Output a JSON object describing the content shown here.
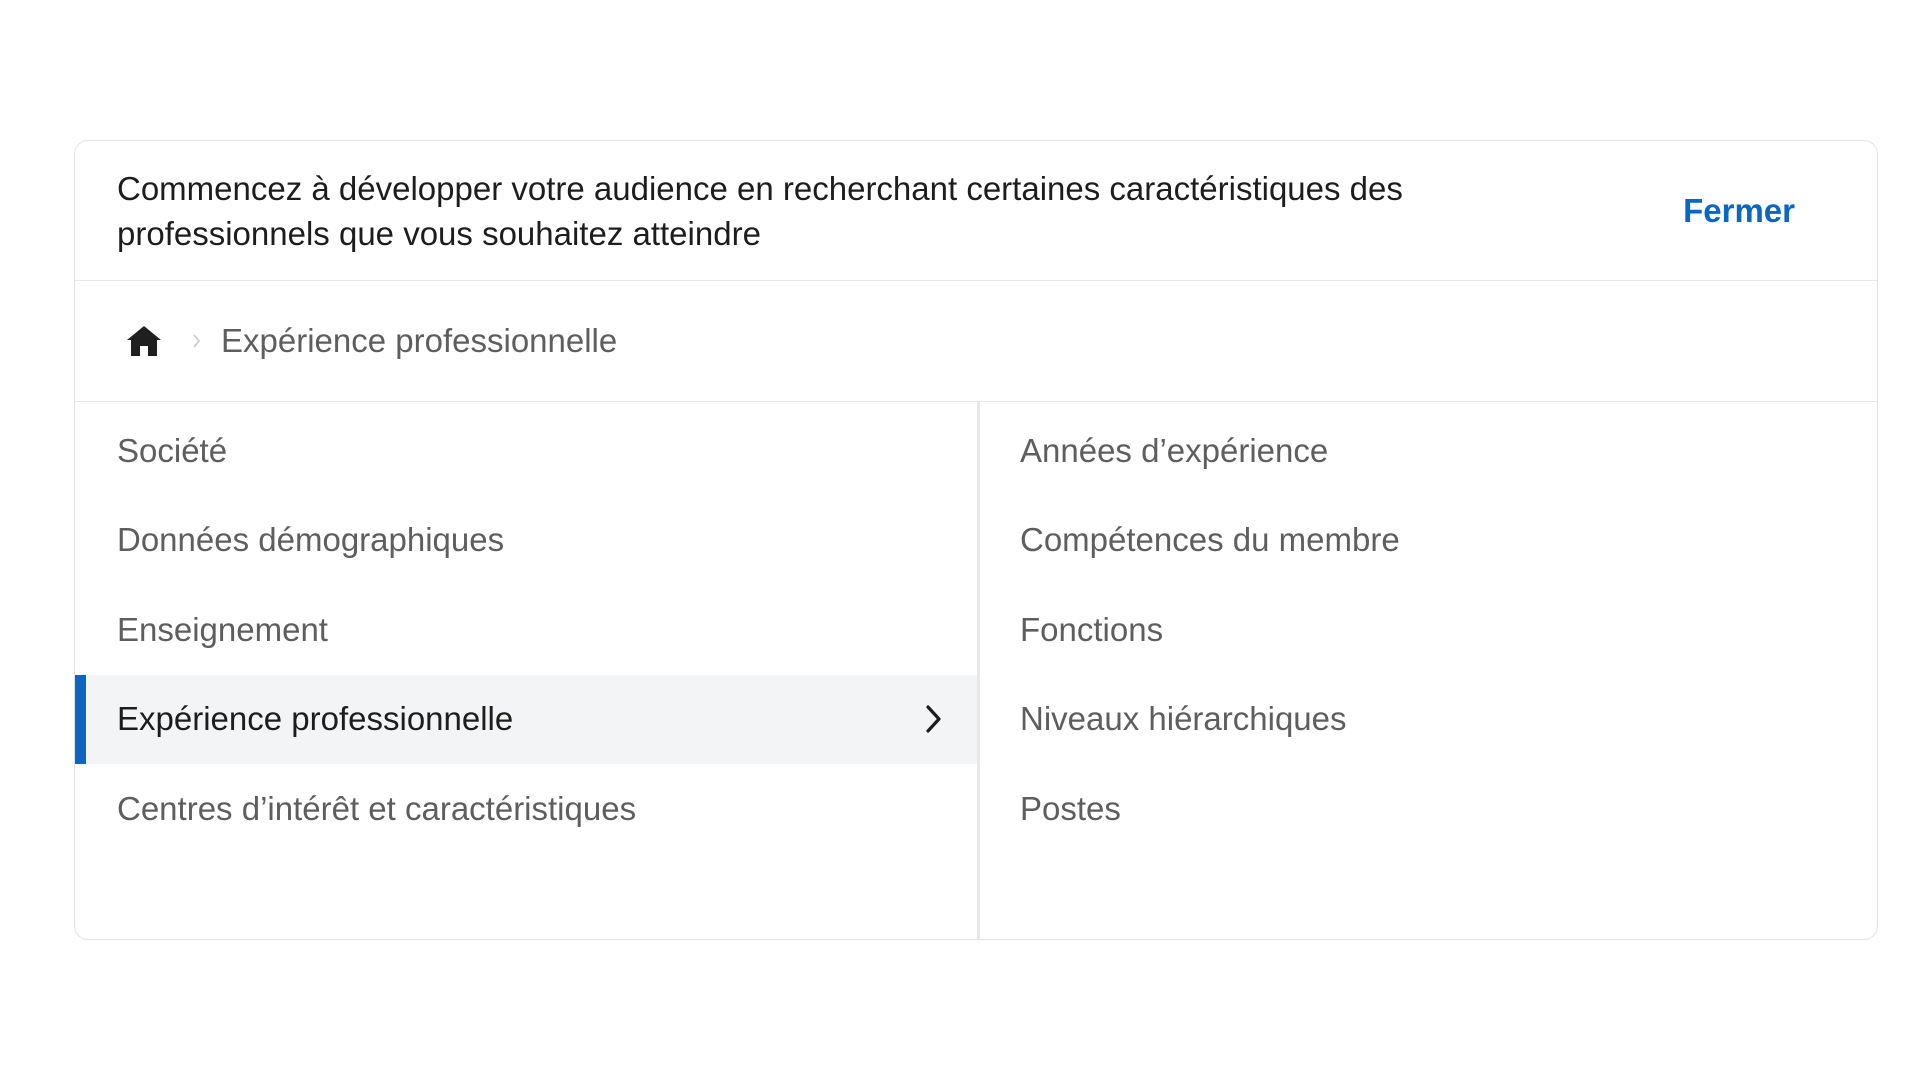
{
  "header": {
    "text": "Commencez à développer votre audience en recherchant certaines caractéristiques des professionnels que vous souhaitez atteindre",
    "close_label": "Fermer"
  },
  "breadcrumb": {
    "home_icon": "home-icon",
    "separator_icon": "chevron-right-icon",
    "current": "Expérience professionnelle"
  },
  "categories": {
    "items": [
      {
        "label": "Société"
      },
      {
        "label": "Données démographiques"
      },
      {
        "label": "Enseignement"
      },
      {
        "label": "Expérience professionnelle"
      },
      {
        "label": "Centres d’intérêt et caractéristiques"
      }
    ],
    "active_index": 3
  },
  "subcategories": {
    "items": [
      {
        "label": "Années d’expérience"
      },
      {
        "label": "Compétences du membre"
      },
      {
        "label": "Fonctions"
      },
      {
        "label": "Niveaux hiérarchiques"
      },
      {
        "label": "Postes"
      }
    ]
  },
  "colors": {
    "accent": "#0a66c2",
    "active_bg": "#f3f4f5",
    "text_primary": "#1d1d1d",
    "text_secondary": "#5e5e5e"
  }
}
